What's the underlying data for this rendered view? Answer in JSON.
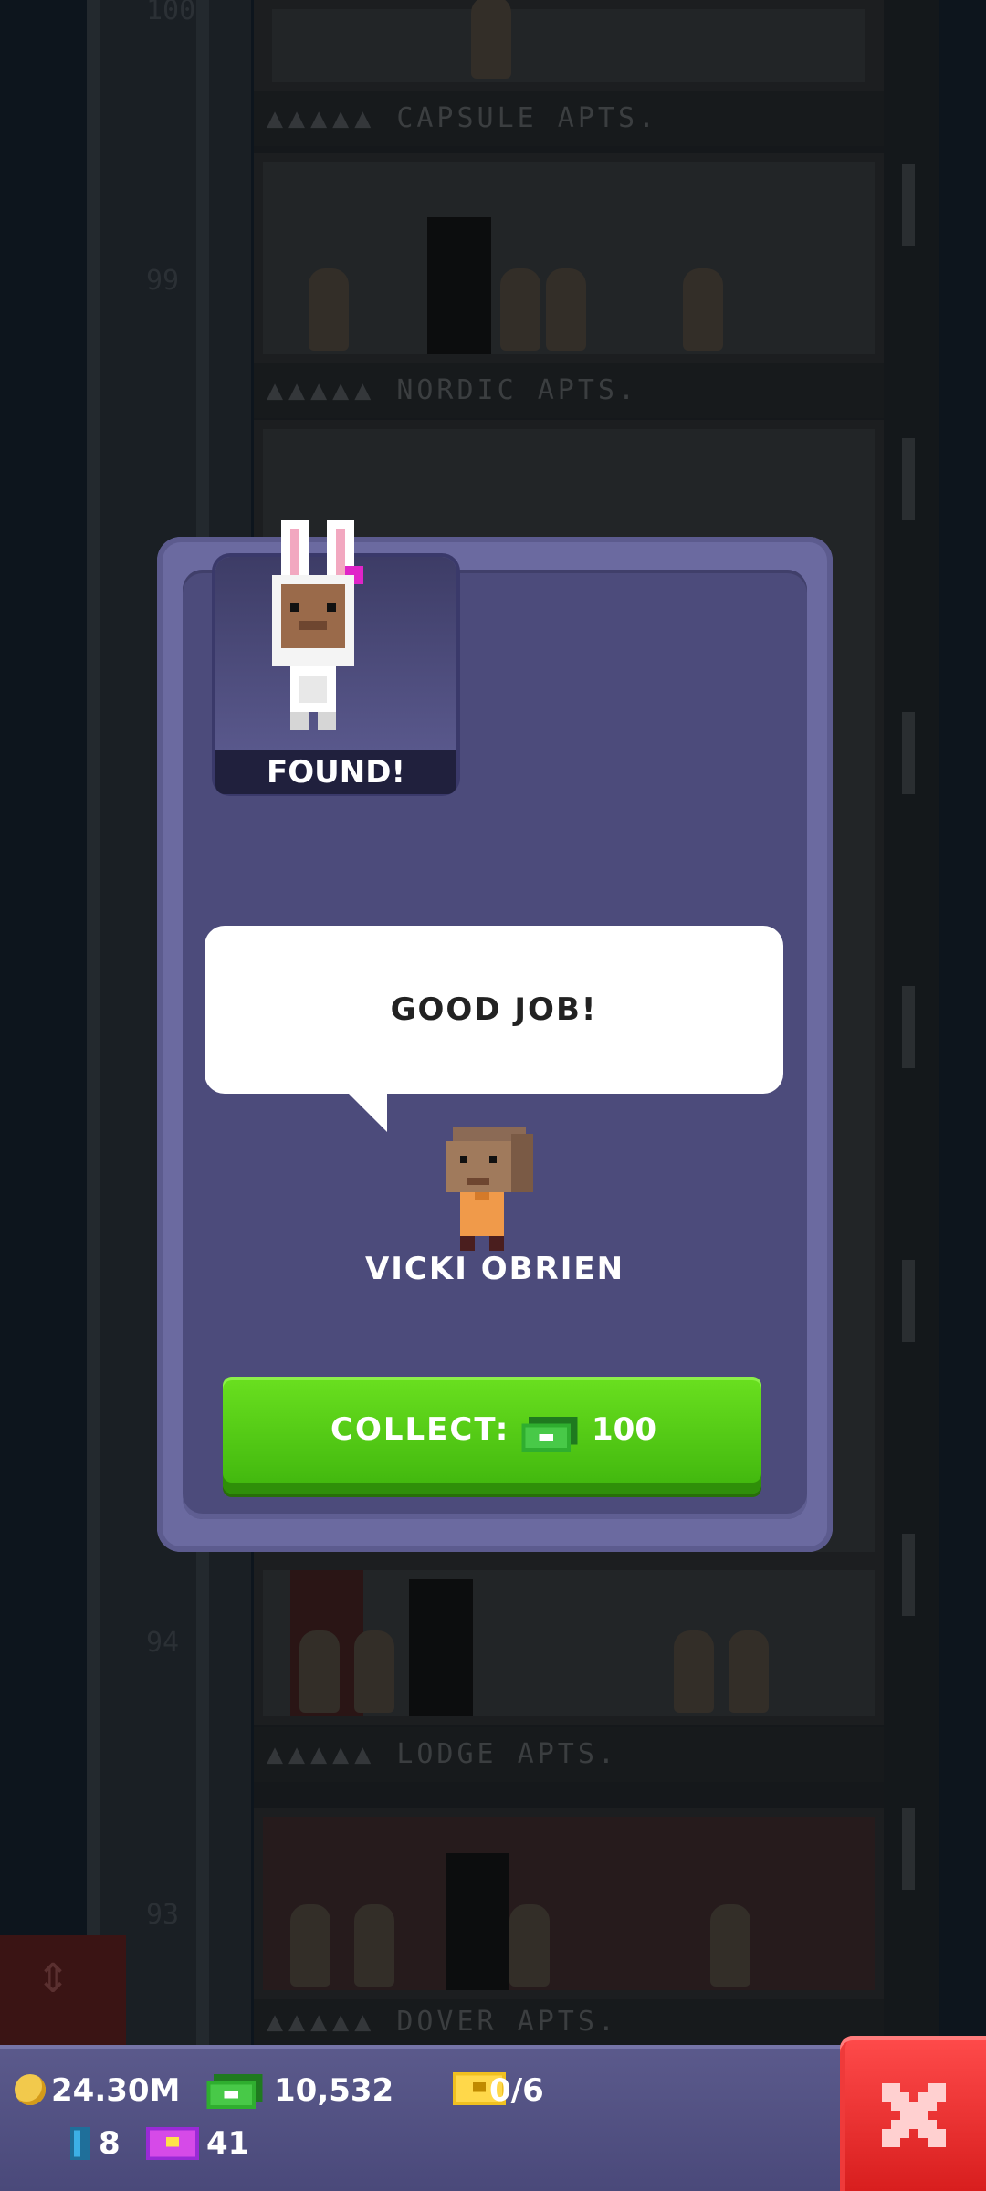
{
  "background": {
    "floors": [
      {
        "name": "CAPSULE APTS.",
        "num": "100"
      },
      {
        "name": "NORDIC APTS.",
        "num": "99"
      },
      {
        "name": "LODGE APTS.",
        "num": "94"
      },
      {
        "name": "DOVER APTS.",
        "num": "93"
      }
    ],
    "stars": "▲▲▲▲▲"
  },
  "modal": {
    "found_label": "FOUND!",
    "speech": "GOOD JOB!",
    "npc_name": "VICKI OBRIEN",
    "collect_label": "COLLECT:",
    "collect_amount": "100",
    "collect_icon": "tower-bux-icon"
  },
  "status": {
    "coins": "24.30M",
    "bux": "10,532",
    "tickets": "0/6",
    "keys": "8",
    "vip": "41"
  },
  "colors": {
    "modal": "#4c4b7b",
    "collect_button": "#52cc14",
    "close_button": "#e52a2a",
    "coin": "#f2c94c"
  }
}
